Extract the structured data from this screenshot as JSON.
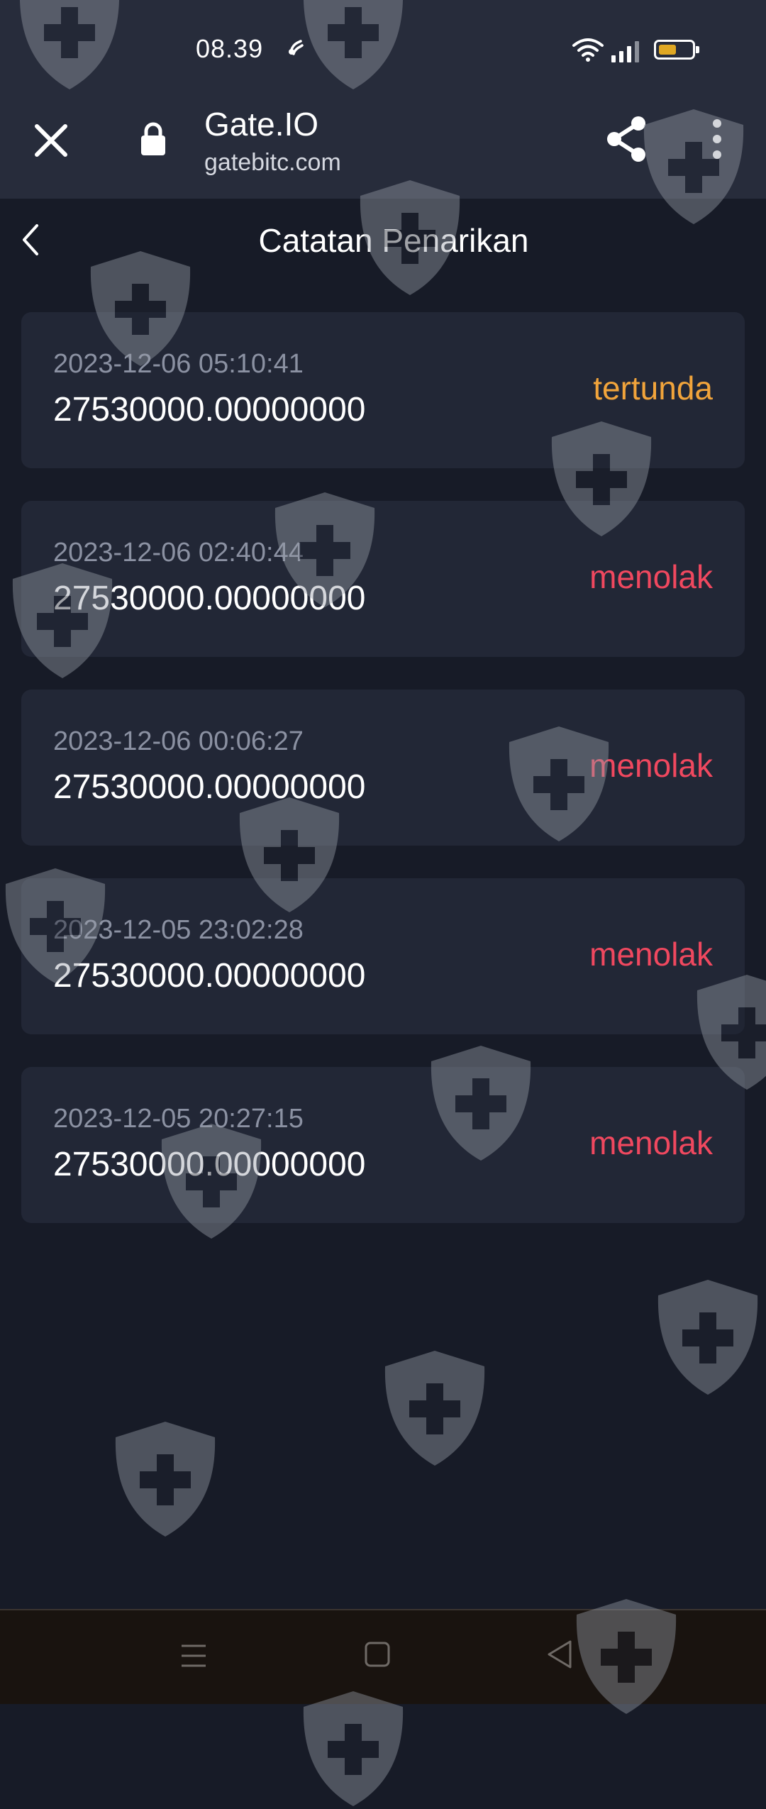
{
  "status_bar": {
    "time": "08.39",
    "icons": [
      "notification-icon",
      "wifi-icon",
      "signal-icon",
      "battery-icon"
    ],
    "battery_level": 0.55,
    "battery_color": "#e0a823"
  },
  "browser": {
    "title": "Gate.IO",
    "url": "gatebitc.com",
    "icons": [
      "close-icon",
      "lock-icon",
      "share-icon",
      "more-icon"
    ]
  },
  "page": {
    "title": "Catatan Penarikan",
    "back_icon": "chevron-left-icon"
  },
  "colors": {
    "pending": "#f1a43b",
    "rejected": "#f0485f",
    "card_bg": "#222736",
    "page_bg": "#171b27"
  },
  "records": [
    {
      "time": "2023-12-06 05:10:41",
      "amount": "27530000.00000000",
      "status": "tertunda",
      "status_type": "pending"
    },
    {
      "time": "2023-12-06 02:40:44",
      "amount": "27530000.00000000",
      "status": "menolak",
      "status_type": "rejected"
    },
    {
      "time": "2023-12-06 00:06:27",
      "amount": "27530000.00000000",
      "status": "menolak",
      "status_type": "rejected"
    },
    {
      "time": "2023-12-05 23:02:28",
      "amount": "27530000.00000000",
      "status": "menolak",
      "status_type": "rejected"
    },
    {
      "time": "2023-12-05 20:27:15",
      "amount": "27530000.00000000",
      "status": "menolak",
      "status_type": "rejected"
    }
  ],
  "nav_bar": {
    "icons": [
      "menu-icon",
      "home-icon",
      "back-icon"
    ]
  },
  "watermark_icon": "shield-cross-icon"
}
